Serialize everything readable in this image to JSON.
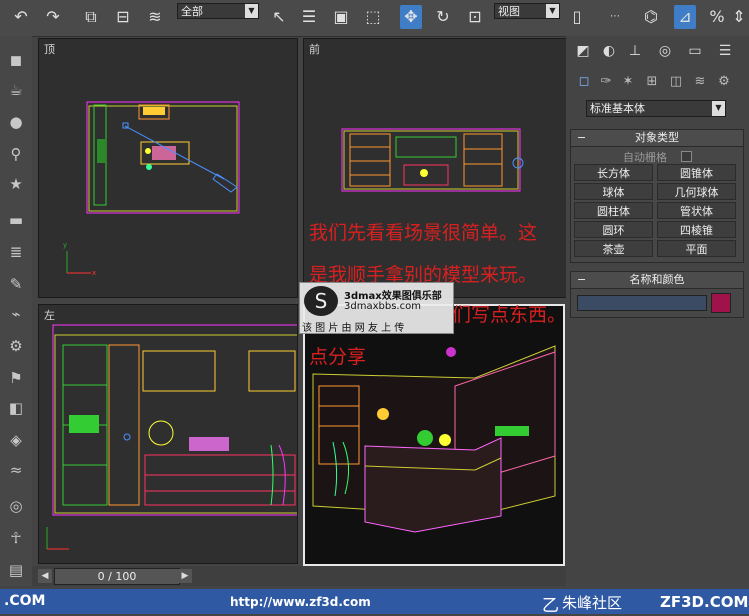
{
  "toolbar": {
    "selection_filter": "全部",
    "reference_coord": "视图"
  },
  "viewports": {
    "top": {
      "label": "顶"
    },
    "front": {
      "label": "前"
    },
    "left": {
      "label": "左"
    }
  },
  "command_panel": {
    "category_dropdown": "标准基本体",
    "object_type": {
      "title": "对象类型",
      "autogrid_label": "自动栅格",
      "buttons": [
        "长方体",
        "圆锥体",
        "球体",
        "几何球体",
        "圆柱体",
        "管状体",
        "圆环",
        "四棱锥",
        "茶壶",
        "平面"
      ]
    },
    "name_color": {
      "title": "名称和颜色",
      "object_name": "",
      "color": "#a0134a"
    }
  },
  "timeline": {
    "frame_display": "0 / 100"
  },
  "overlay": {
    "lines": [
      "我们先看看场景很简单。这",
      "是我顺手拿别的模型来玩。",
      "们写点东西。做",
      "点分享"
    ]
  },
  "watermark": {
    "line1": "3dmax效果图俱乐部",
    "line2": "3dmaxbbs.com",
    "line3": "该 图 片 由 网 友 上 传"
  },
  "status_bar": {
    "left": ".COM",
    "url": "http://www.zf3d.com",
    "brand": "朱峰社区",
    "right": "ZF3D.COM"
  },
  "colors": {
    "accent": "#3f7ec7",
    "overlay_text": "#d82020",
    "status_bar": "#2f59a3"
  }
}
